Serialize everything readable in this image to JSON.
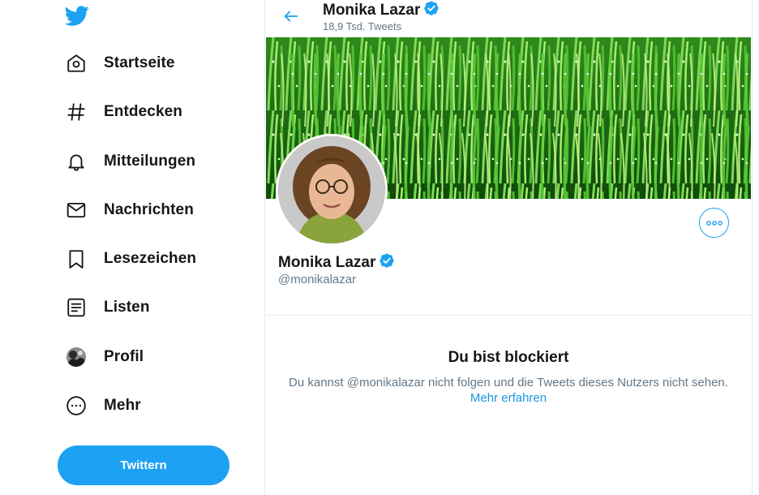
{
  "sidebar": {
    "logo": "twitter-bird-icon",
    "items": [
      {
        "label": "Startseite",
        "icon": "home-icon"
      },
      {
        "label": "Entdecken",
        "icon": "hashtag-icon"
      },
      {
        "label": "Mitteilungen",
        "icon": "bell-icon"
      },
      {
        "label": "Nachrichten",
        "icon": "envelope-icon"
      },
      {
        "label": "Lesezeichen",
        "icon": "bookmark-icon"
      },
      {
        "label": "Listen",
        "icon": "list-icon"
      },
      {
        "label": "Profil",
        "icon": "avatar-icon"
      },
      {
        "label": "Mehr",
        "icon": "more-circle-icon"
      }
    ],
    "tweet_button": "Twittern"
  },
  "header": {
    "name": "Monika Lazar",
    "tweet_count": "18,9 Tsd. Tweets"
  },
  "profile": {
    "name": "Monika Lazar",
    "handle": "@monikalazar"
  },
  "blocked": {
    "title": "Du bist blockiert",
    "text": "Du kannst @monikalazar nicht folgen und die Tweets dieses Nutzers nicht sehen.",
    "link": "Mehr erfahren"
  },
  "colors": {
    "accent": "#1da1f2",
    "verified": "#1da1f2",
    "muted": "#657786"
  }
}
